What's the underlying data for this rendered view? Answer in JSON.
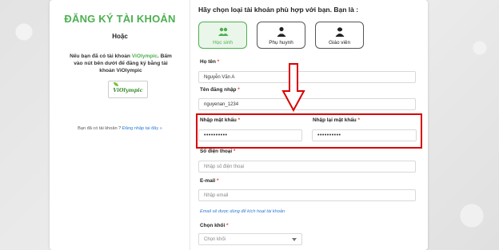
{
  "left_panel": {
    "title": "ĐĂNG KÝ TÀI KHOẢN",
    "or_text": "Hoặc",
    "note_prefix": "Nếu bạn đã có tài khoản ",
    "note_brand": "ViOlympic",
    "note_suffix": ". Bấm vào nút bên dưới để đăng ký bằng tài khoản ViOlympic",
    "logo_text": "ViOlympic",
    "has_account_text": "Bạn đã có tài khoản ? ",
    "login_link": "Đăng nhập tại đây »"
  },
  "form": {
    "question": "Hãy chọn loại tài khoản phù hợp với bạn. Bạn là :",
    "roles": [
      {
        "label": "Học sinh",
        "active": true,
        "icon": "student-icon"
      },
      {
        "label": "Phụ huynh",
        "active": false,
        "icon": "parent-icon"
      },
      {
        "label": "Giáo viên",
        "active": false,
        "icon": "teacher-icon"
      }
    ],
    "fullname": {
      "label": "Họ tên",
      "value": "Nguyễn Văn A"
    },
    "username": {
      "label": "Tên đăng nhập",
      "value": "nguyenan_1234"
    },
    "password": {
      "label": "Nhập mật khẩu",
      "value": "••••••••••"
    },
    "password_confirm": {
      "label": "Nhập lại mật khẩu",
      "value": "••••••••••"
    },
    "phone": {
      "label": "Số điện thoại",
      "placeholder": "Nhập số điện thoại"
    },
    "email": {
      "label": "E-mail",
      "placeholder": "Nhập email",
      "hint": "Email sẽ được dùng để kích hoạt tài khoản"
    },
    "grade": {
      "label": "Chọn khối",
      "placeholder": "Chọn khối"
    },
    "required_mark": "*"
  },
  "colors": {
    "brand_green": "#4caf50",
    "link_blue": "#2b7bd3",
    "highlight_red": "#d90000",
    "required_red": "#e53935"
  }
}
